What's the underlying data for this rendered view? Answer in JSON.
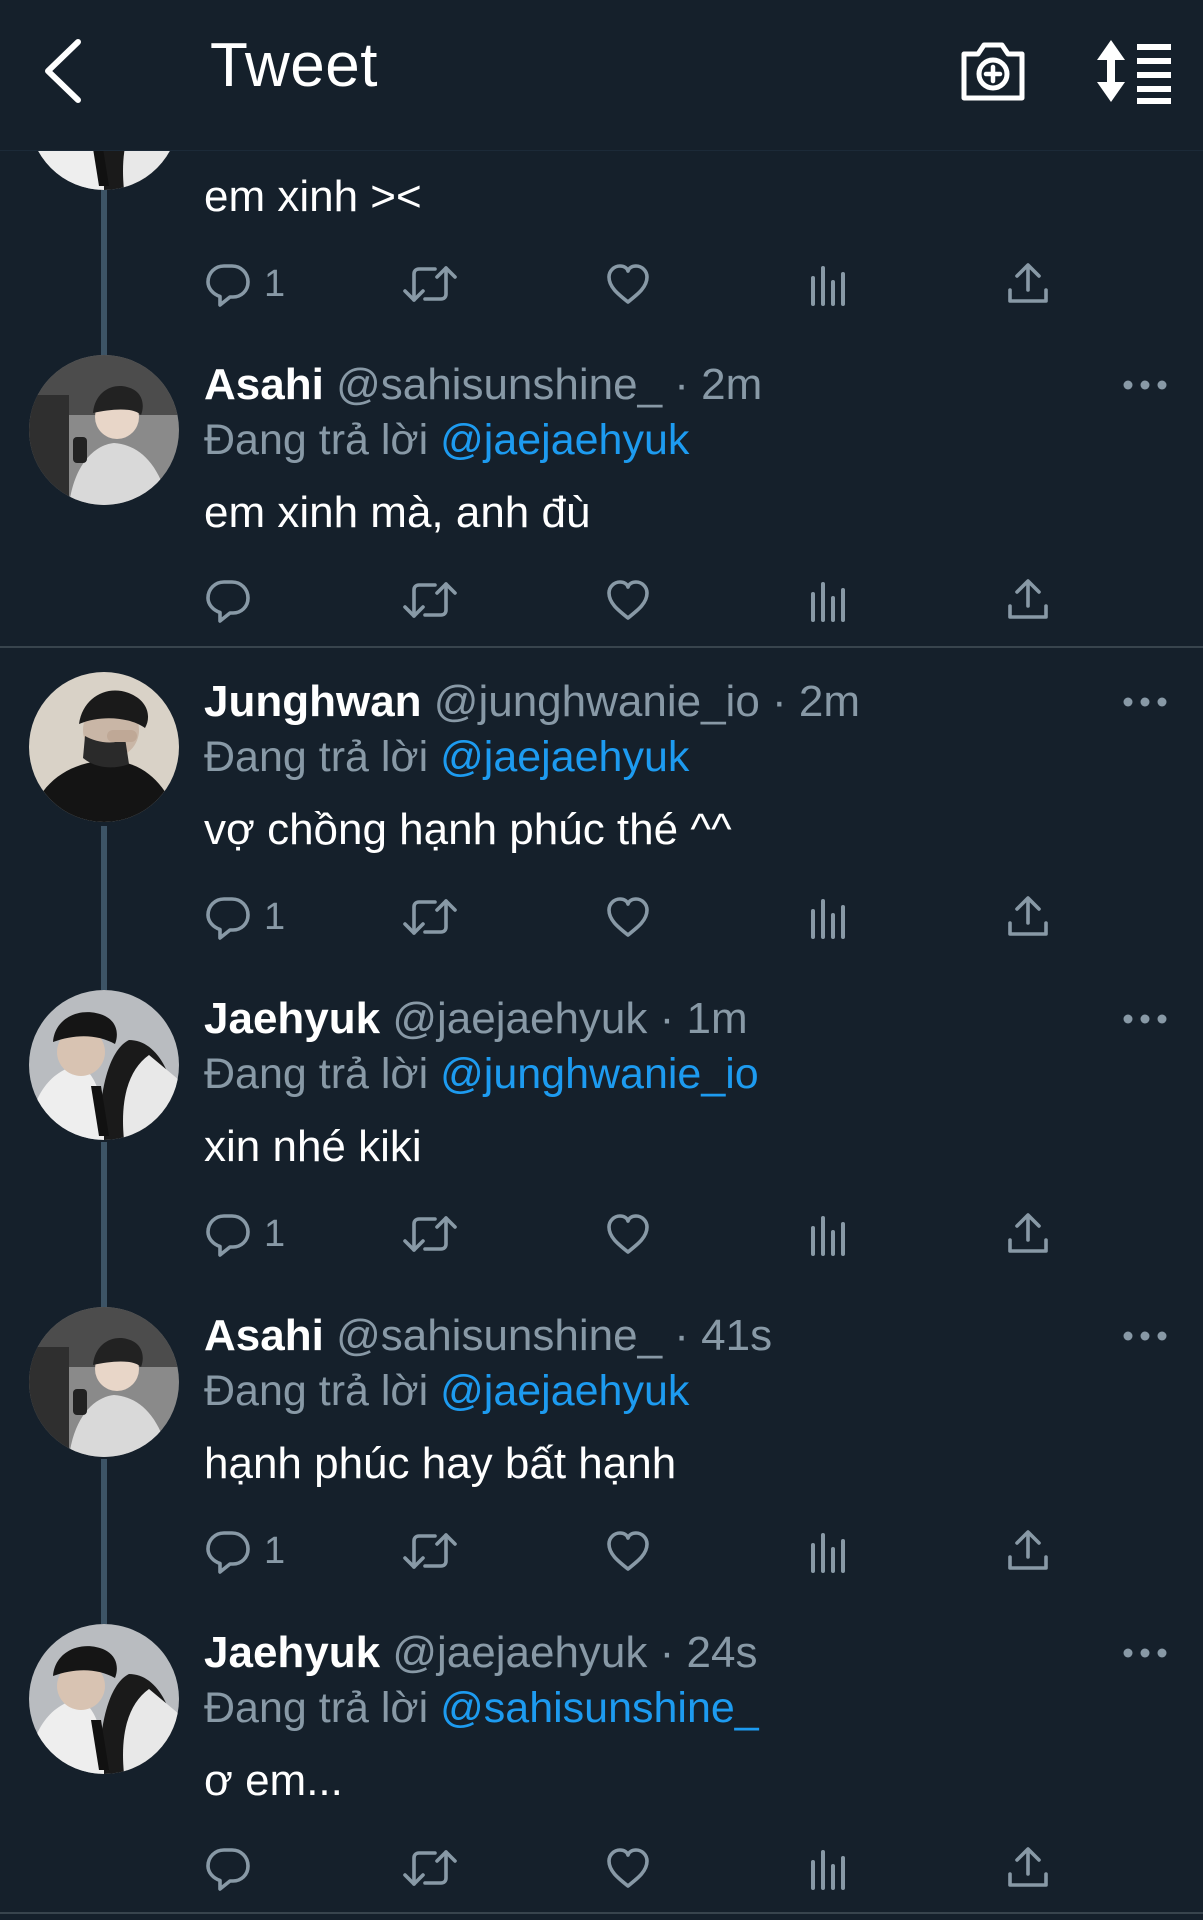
{
  "header": {
    "title": "Tweet",
    "back_icon": "chevron-left-icon",
    "camera_icon": "camera-add-icon",
    "sort_icon": "sort-list-icon"
  },
  "colors": {
    "background": "#15202b",
    "link": "#1d9bf0",
    "muted": "#8899a6",
    "thread_line": "#3d5466"
  },
  "tweets": [
    {
      "text": "em xinh ><",
      "reply_count": "1"
    },
    {
      "name": "Asahi",
      "handle": "@sahisunshine_",
      "sep": " · ",
      "time": "2m",
      "reply_prefix": "Đang trả lời ",
      "reply_to": "@jaejaehyuk",
      "text": "em xinh mà, anh đù",
      "reply_count": ""
    },
    {
      "name": "Junghwan",
      "handle": "@junghwanie_io",
      "sep": " · ",
      "time": "2m",
      "reply_prefix": "Đang trả lời ",
      "reply_to": "@jaejaehyuk",
      "text": "vợ chồng hạnh phúc thé ^^",
      "reply_count": "1"
    },
    {
      "name": "Jaehyuk",
      "handle": "@jaejaehyuk",
      "sep": " · ",
      "time": "1m",
      "reply_prefix": "Đang trả lời ",
      "reply_to": "@junghwanie_io",
      "text": "xin nhé kiki",
      "reply_count": "1"
    },
    {
      "name": "Asahi",
      "handle": "@sahisunshine_",
      "sep": " · ",
      "time": "41s",
      "reply_prefix": "Đang trả lời ",
      "reply_to": "@jaejaehyuk",
      "text": "hạnh phúc hay bất hạnh",
      "reply_count": "1"
    },
    {
      "name": "Jaehyuk",
      "handle": "@jaejaehyuk",
      "sep": " · ",
      "time": "24s",
      "reply_prefix": "Đang trả lời ",
      "reply_to": "@sahisunshine_",
      "text": "ơ em...",
      "reply_count": ""
    }
  ]
}
